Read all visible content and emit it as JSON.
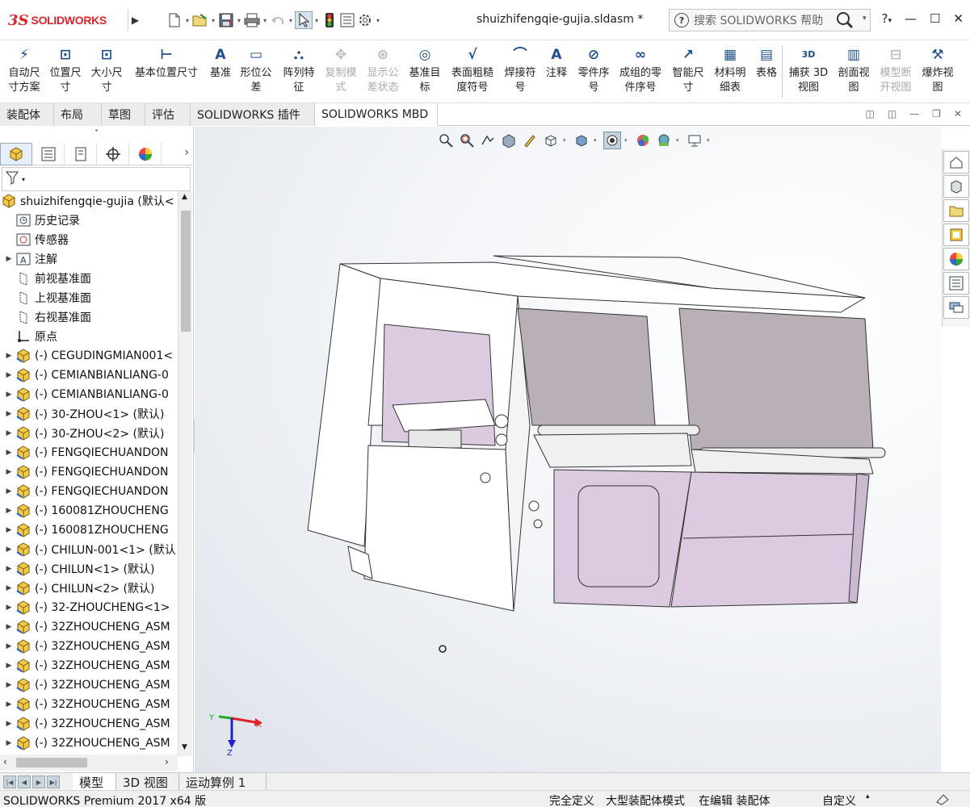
{
  "app": {
    "logo_prefix": "3S",
    "logo_name": "SOLIDWORKS",
    "document_title": "shuizhifengqie-gujia.sldasm *",
    "search_placeholder": "搜索 SOLIDWORKS 帮助",
    "help_label": "?"
  },
  "ribbon": {
    "buttons": [
      {
        "line1": "自动尺",
        "line2": "寸方案",
        "icon": "auto-dim-icon",
        "enabled": true
      },
      {
        "line1": "位置尺",
        "line2": "寸",
        "icon": "location-dim-icon",
        "enabled": true
      },
      {
        "line1": "大小尺",
        "line2": "寸",
        "icon": "size-dim-icon",
        "enabled": true
      },
      {
        "line1": "基本位置尺寸",
        "line2": "",
        "icon": "basic-location-dim-icon",
        "enabled": true
      },
      {
        "line1": "基准",
        "line2": "",
        "icon": "datum-icon",
        "enabled": true
      },
      {
        "line1": "形位公",
        "line2": "差",
        "icon": "geometric-tolerance-icon",
        "enabled": true
      },
      {
        "line1": "阵列特",
        "line2": "征",
        "icon": "pattern-feature-icon",
        "enabled": true
      },
      {
        "line1": "复制模",
        "line2": "式",
        "icon": "copy-scheme-icon",
        "enabled": false
      },
      {
        "line1": "显示公",
        "line2": "差状态",
        "icon": "show-tolerance-status-icon",
        "enabled": false
      },
      {
        "line1": "基准目",
        "line2": "标",
        "icon": "datum-target-icon",
        "enabled": true
      },
      {
        "line1": "表面粗糙",
        "line2": "度符号",
        "icon": "surface-finish-icon",
        "enabled": true
      },
      {
        "line1": "焊接符",
        "line2": "号",
        "icon": "weld-symbol-icon",
        "enabled": true
      },
      {
        "line1": "注释",
        "line2": "",
        "icon": "note-icon",
        "enabled": true
      },
      {
        "line1": "零件序",
        "line2": "号",
        "icon": "balloon-icon",
        "enabled": true
      },
      {
        "line1": "成组的零",
        "line2": "件序号",
        "icon": "stacked-balloon-icon",
        "enabled": true
      },
      {
        "line1": "智能尺",
        "line2": "寸",
        "icon": "smart-dimension-icon",
        "enabled": true
      },
      {
        "line1": "材料明",
        "line2": "细表",
        "icon": "bom-icon",
        "enabled": true
      },
      {
        "line1": "表格",
        "line2": "",
        "icon": "table-icon",
        "enabled": true
      },
      {
        "line1": "捕获 3D",
        "line2": "视图",
        "icon": "capture-3d-view-icon",
        "enabled": true
      },
      {
        "line1": "剖面视",
        "line2": "图",
        "icon": "section-view-icon",
        "enabled": true
      },
      {
        "line1": "模型断",
        "line2": "开视图",
        "icon": "model-break-view-icon",
        "enabled": false
      },
      {
        "line1": "爆炸视",
        "line2": "图",
        "icon": "exploded-view-icon",
        "enabled": true
      }
    ]
  },
  "cm_tabs": [
    {
      "label": "装配体",
      "active": false
    },
    {
      "label": "布局",
      "active": false
    },
    {
      "label": "草图",
      "active": false
    },
    {
      "label": "评估",
      "active": false
    },
    {
      "label": "SOLIDWORKS 插件",
      "active": false
    },
    {
      "label": "SOLIDWORKS MBD",
      "active": true
    }
  ],
  "tree": {
    "root": "shuizhifengqie-gujia  (默认<",
    "items": [
      {
        "label": "历史记录",
        "icon": "history-icon",
        "expandable": false
      },
      {
        "label": "传感器",
        "icon": "sensor-icon",
        "expandable": false
      },
      {
        "label": "注解",
        "icon": "annotation-icon",
        "expandable": true
      },
      {
        "label": "前视基准面",
        "icon": "plane-icon",
        "expandable": false
      },
      {
        "label": "上视基准面",
        "icon": "plane-icon",
        "expandable": false
      },
      {
        "label": "右视基准面",
        "icon": "plane-icon",
        "expandable": false
      },
      {
        "label": "原点",
        "icon": "origin-icon",
        "expandable": false
      },
      {
        "label": "(-) CEGUDINGMIAN001<",
        "icon": "part-icon",
        "expandable": true
      },
      {
        "label": "(-) CEMIANBIANLIANG-0",
        "icon": "part-icon",
        "expandable": true
      },
      {
        "label": "(-) CEMIANBIANLIANG-0",
        "icon": "part-icon",
        "expandable": true
      },
      {
        "label": "(-) 30-ZHOU<1> (默认)",
        "icon": "part-icon",
        "expandable": true
      },
      {
        "label": "(-) 30-ZHOU<2> (默认)",
        "icon": "part-icon",
        "expandable": true
      },
      {
        "label": "(-) FENGQIECHUANDON",
        "icon": "part-icon",
        "expandable": true
      },
      {
        "label": "(-) FENGQIECHUANDON",
        "icon": "part-icon",
        "expandable": true
      },
      {
        "label": "(-) FENGQIECHUANDON",
        "icon": "part-icon",
        "expandable": true
      },
      {
        "label": "(-) 160081ZHOUCHENG",
        "icon": "part-icon",
        "expandable": true
      },
      {
        "label": "(-) 160081ZHOUCHENG",
        "icon": "part-icon",
        "expandable": true
      },
      {
        "label": "(-) CHILUN-001<1> (默认",
        "icon": "part-icon",
        "expandable": true
      },
      {
        "label": "(-) CHILUN<1> (默认)",
        "icon": "part-icon",
        "expandable": true
      },
      {
        "label": "(-) CHILUN<2> (默认)",
        "icon": "part-icon",
        "expandable": true
      },
      {
        "label": "(-) 32-ZHOUCHENG<1>",
        "icon": "part-icon",
        "expandable": true
      },
      {
        "label": "(-) 32ZHOUCHENG_ASM",
        "icon": "part-icon",
        "expandable": true
      },
      {
        "label": "(-) 32ZHOUCHENG_ASM",
        "icon": "part-icon",
        "expandable": true
      },
      {
        "label": "(-) 32ZHOUCHENG_ASM",
        "icon": "part-icon",
        "expandable": true
      },
      {
        "label": "(-) 32ZHOUCHENG_ASM",
        "icon": "part-icon",
        "expandable": true
      },
      {
        "label": "(-) 32ZHOUCHENG_ASM",
        "icon": "part-icon",
        "expandable": true
      },
      {
        "label": "(-) 32ZHOUCHENG_ASM",
        "icon": "part-icon",
        "expandable": true
      },
      {
        "label": "(-) 32ZHOUCHENG_ASM",
        "icon": "part-icon",
        "expandable": true
      }
    ]
  },
  "triad": {
    "x": "X",
    "y": "Y",
    "z": "Z"
  },
  "bottom_tabs": [
    {
      "label": "模型",
      "active": true
    },
    {
      "label": "3D 视图",
      "active": false
    },
    {
      "label": "运动算例 1",
      "active": false
    }
  ],
  "status": {
    "product": "SOLIDWORKS Premium 2017 x64 版",
    "definition": "完全定义",
    "mode": "大型装配体模式",
    "editing": "在编辑 装配体",
    "units": "自定义"
  },
  "colors": {
    "brand": "#d9262a",
    "panel_fill": "#dccbe0",
    "glass_fill": "#b8b0b6"
  }
}
